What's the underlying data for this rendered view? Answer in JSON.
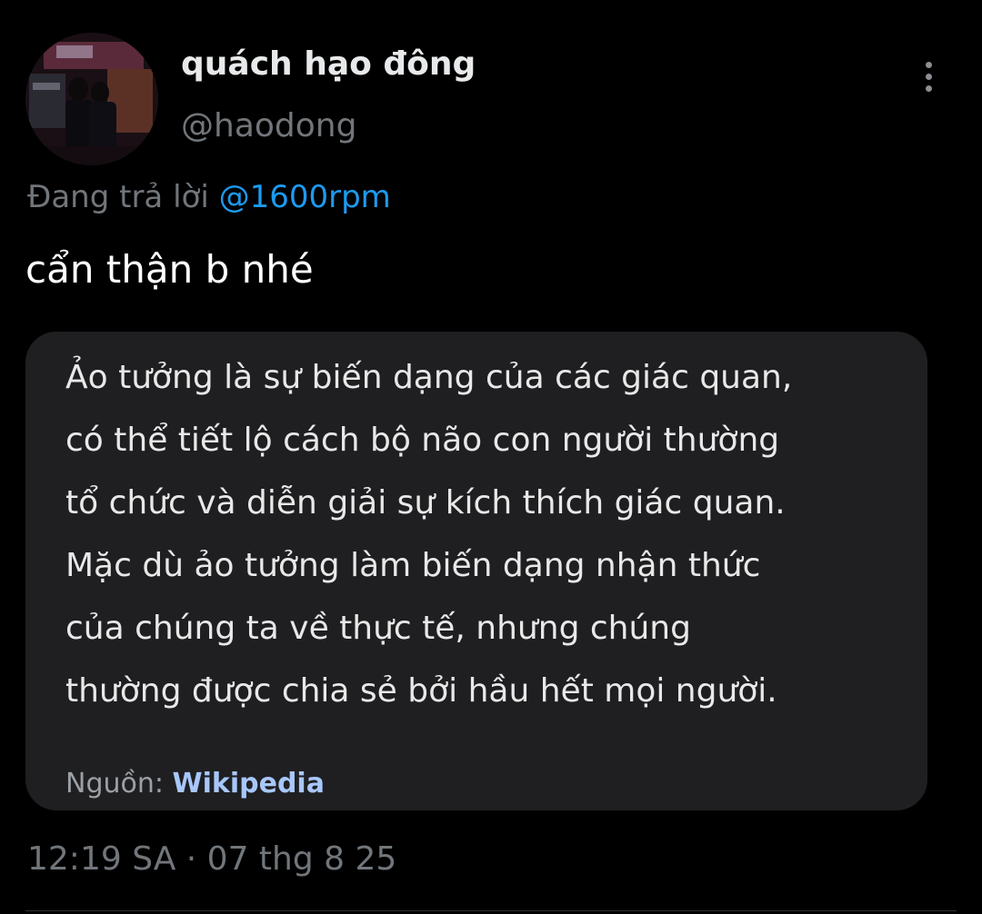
{
  "tweet": {
    "author": {
      "display_name": "quách hạo đông",
      "handle": "@haodong"
    },
    "reply": {
      "prefix": "Đang trả lời",
      "mention": "@1600rpm"
    },
    "text": "cẩn thận b nhé",
    "quote": {
      "lines": [
        "Ảo tưởng là sự biến dạng của các giác quan,",
        "có thể tiết lộ cách bộ não con người thường",
        "tổ chức và diễn giải sự kích thích giác quan.",
        "Mặc dù ảo tưởng làm biến dạng nhận thức",
        "của chúng ta về thực tế, nhưng chúng",
        "thường được chia sẻ bởi hầu hết mọi người."
      ],
      "source_label": "Nguồn:",
      "source_name": "Wikipedia"
    },
    "timestamp": "12:19 SA · 07 thg 8 25"
  },
  "icons": {
    "more": "more-vertical-icon"
  },
  "colors": {
    "background": "#000000",
    "mention": "#1d9bf0",
    "secondary_text": "#71767b",
    "quote_card": "#1f1f21",
    "source_link": "#a8c7fa"
  }
}
